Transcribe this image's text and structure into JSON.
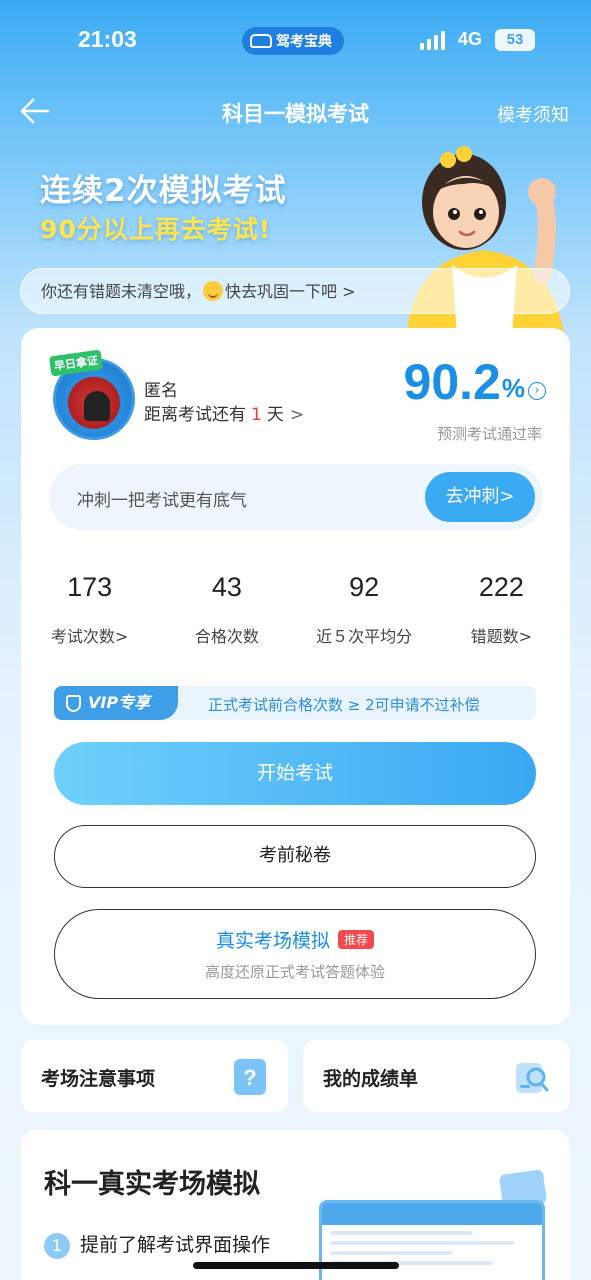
{
  "status_bar": {
    "time": "21:03",
    "app_pill": "驾考宝典",
    "network": "4G",
    "battery": "53"
  },
  "nav": {
    "title": "科目一模拟考试",
    "notice": "模考须知"
  },
  "hero": {
    "line1": "连续2次模拟考试",
    "line2": "90分以上再去考试!"
  },
  "tip": {
    "text_before": "你还有错题未清空哦，",
    "text_after": "快去巩固一下吧 >"
  },
  "profile": {
    "avatar_tag": "早日拿证",
    "name": "匿名",
    "countdown_prefix": "距离考试还有",
    "countdown_days": "1",
    "countdown_suffix": "天",
    "chevron": ">",
    "pass_rate": "90.2",
    "pass_rate_unit": "%",
    "pass_rate_label": "预测考试通过率"
  },
  "sprint": {
    "text": "冲刺一把考试更有底气",
    "button": "去冲刺>"
  },
  "stats": [
    {
      "value": "173",
      "label": "考试次数>"
    },
    {
      "value": "43",
      "label": "合格次数"
    },
    {
      "value": "92",
      "label": "近５次平均分"
    },
    {
      "value": "222",
      "label": "错题数>"
    }
  ],
  "vip": {
    "badge": "VIP专享",
    "text": "正式考试前合格次数 ≥ 2可申请不过补偿"
  },
  "actions": {
    "start": "开始考试",
    "secret": "考前秘卷",
    "real_title": "真实考场模拟",
    "real_badge": "推荐",
    "real_sub": "高度还原正式考试答题体验"
  },
  "mini_cards": [
    {
      "title": "考场注意事项",
      "icon": "question-doc-icon"
    },
    {
      "title": "我的成绩单",
      "icon": "search-doc-icon"
    }
  ],
  "bottom": {
    "title": "科一真实考场模拟",
    "step_num": "1",
    "step_text": "提前了解考试界面操作"
  },
  "colors": {
    "primary": "#1a8fe6",
    "accent_yellow": "#ffe54d",
    "danger": "#e83b3b"
  }
}
